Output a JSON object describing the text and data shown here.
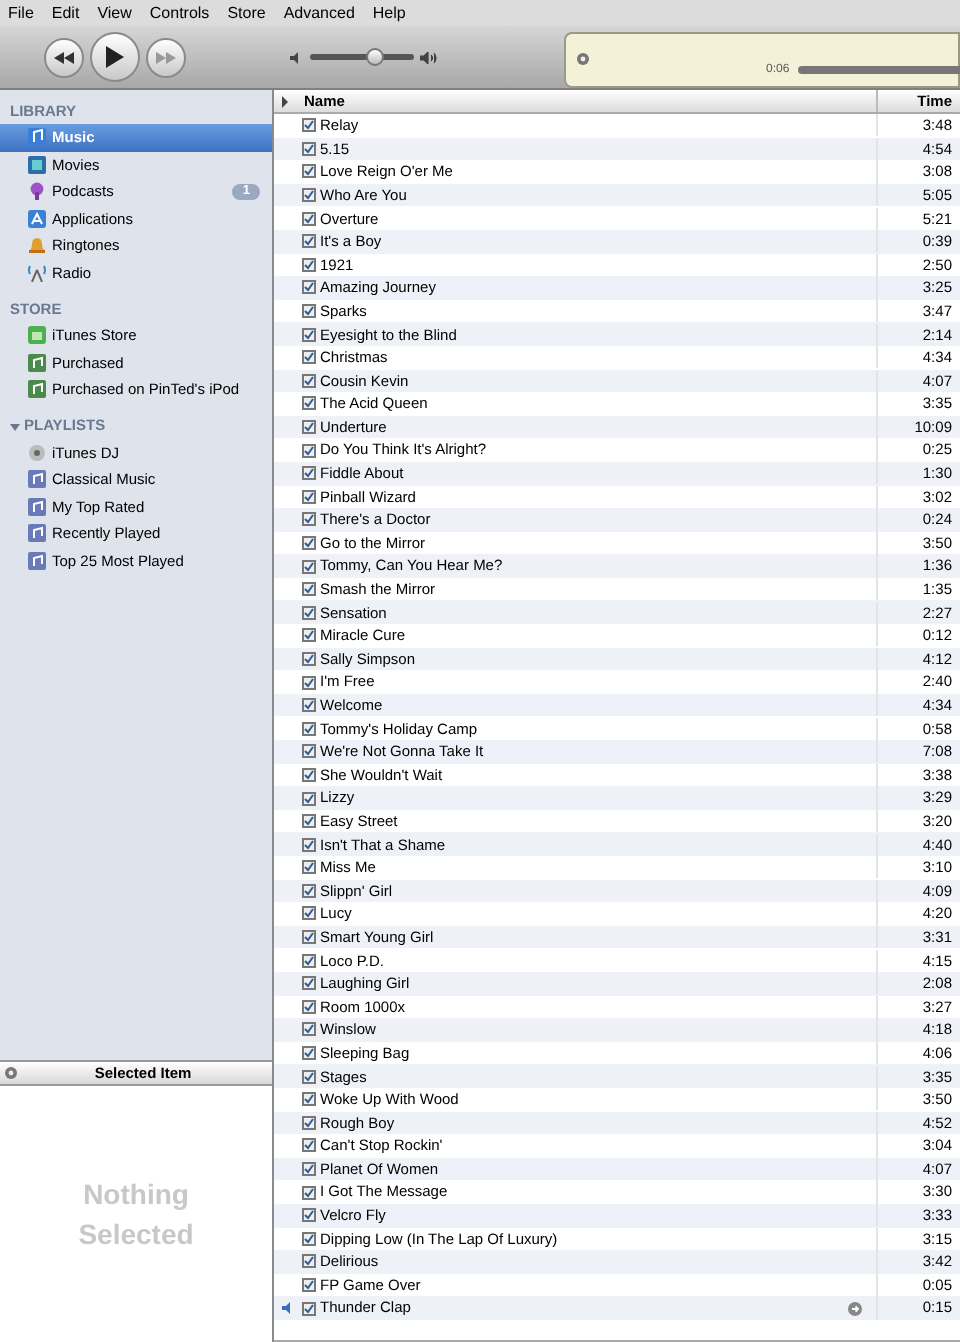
{
  "menu": [
    "File",
    "Edit",
    "View",
    "Controls",
    "Store",
    "Advanced",
    "Help"
  ],
  "volume": {
    "level": 0.63
  },
  "display": {
    "elapsed": "0:06"
  },
  "sidebar": [
    {
      "heading": "LIBRARY",
      "items": [
        {
          "label": "Music",
          "kind": "music",
          "selected": true
        },
        {
          "label": "Movies",
          "kind": "movie",
          "selected": false
        },
        {
          "label": "Podcasts",
          "kind": "podcast",
          "selected": false,
          "badge": "1"
        },
        {
          "label": "Applications",
          "kind": "app",
          "selected": false
        },
        {
          "label": "Ringtones",
          "kind": "bell",
          "selected": false
        },
        {
          "label": "Radio",
          "kind": "radio",
          "selected": false
        }
      ]
    },
    {
      "heading": "STORE",
      "items": [
        {
          "label": "iTunes Store",
          "kind": "store",
          "selected": false
        },
        {
          "label": "Purchased",
          "kind": "purchased",
          "selected": false
        },
        {
          "label": "Purchased on PinTed's iPod",
          "kind": "purchased",
          "selected": false
        }
      ]
    },
    {
      "heading": "PLAYLISTS",
      "expanded": true,
      "items": [
        {
          "label": "iTunes DJ",
          "kind": "dj",
          "selected": false
        },
        {
          "label": "Classical Music",
          "kind": "playlist",
          "selected": false
        },
        {
          "label": "My Top Rated",
          "kind": "playlist",
          "selected": false
        },
        {
          "label": "Recently Played",
          "kind": "playlist",
          "selected": false
        },
        {
          "label": "Top 25 Most Played",
          "kind": "playlist",
          "selected": false
        }
      ]
    }
  ],
  "artwork": {
    "title": "Selected Item",
    "empty_text": "Nothing Selected"
  },
  "table": {
    "columns": [
      "Name",
      "Time"
    ],
    "rows": [
      {
        "name": "Relay",
        "time": "3:48",
        "checked": true,
        "playing": false
      },
      {
        "name": "5.15",
        "time": "4:54",
        "checked": true,
        "playing": false
      },
      {
        "name": "Love Reign O'er Me",
        "time": "3:08",
        "checked": true,
        "playing": false
      },
      {
        "name": "Who Are You",
        "time": "5:05",
        "checked": true,
        "playing": false
      },
      {
        "name": "Overture",
        "time": "5:21",
        "checked": true,
        "playing": false
      },
      {
        "name": "It's a Boy",
        "time": "0:39",
        "checked": true,
        "playing": false
      },
      {
        "name": "1921",
        "time": "2:50",
        "checked": true,
        "playing": false
      },
      {
        "name": "Amazing Journey",
        "time": "3:25",
        "checked": true,
        "playing": false
      },
      {
        "name": "Sparks",
        "time": "3:47",
        "checked": true,
        "playing": false
      },
      {
        "name": "Eyesight to the Blind",
        "time": "2:14",
        "checked": true,
        "playing": false
      },
      {
        "name": "Christmas",
        "time": "4:34",
        "checked": true,
        "playing": false
      },
      {
        "name": "Cousin Kevin",
        "time": "4:07",
        "checked": true,
        "playing": false
      },
      {
        "name": "The Acid Queen",
        "time": "3:35",
        "checked": true,
        "playing": false
      },
      {
        "name": "Underture",
        "time": "10:09",
        "checked": true,
        "playing": false
      },
      {
        "name": "Do You Think It's Alright?",
        "time": "0:25",
        "checked": true,
        "playing": false
      },
      {
        "name": "Fiddle About",
        "time": "1:30",
        "checked": true,
        "playing": false
      },
      {
        "name": "Pinball Wizard",
        "time": "3:02",
        "checked": true,
        "playing": false
      },
      {
        "name": "There's a Doctor",
        "time": "0:24",
        "checked": true,
        "playing": false
      },
      {
        "name": "Go to the Mirror",
        "time": "3:50",
        "checked": true,
        "playing": false
      },
      {
        "name": "Tommy, Can You Hear Me?",
        "time": "1:36",
        "checked": true,
        "playing": false
      },
      {
        "name": "Smash the Mirror",
        "time": "1:35",
        "checked": true,
        "playing": false
      },
      {
        "name": "Sensation",
        "time": "2:27",
        "checked": true,
        "playing": false
      },
      {
        "name": "Miracle Cure",
        "time": "0:12",
        "checked": true,
        "playing": false
      },
      {
        "name": "Sally Simpson",
        "time": "4:12",
        "checked": true,
        "playing": false
      },
      {
        "name": "I'm Free",
        "time": "2:40",
        "checked": true,
        "playing": false
      },
      {
        "name": "Welcome",
        "time": "4:34",
        "checked": true,
        "playing": false
      },
      {
        "name": "Tommy's Holiday Camp",
        "time": "0:58",
        "checked": true,
        "playing": false
      },
      {
        "name": "We're Not Gonna Take It",
        "time": "7:08",
        "checked": true,
        "playing": false
      },
      {
        "name": "She Wouldn't Wait",
        "time": "3:38",
        "checked": true,
        "playing": false
      },
      {
        "name": "Lizzy",
        "time": "3:29",
        "checked": true,
        "playing": false
      },
      {
        "name": "Easy Street",
        "time": "3:20",
        "checked": true,
        "playing": false
      },
      {
        "name": "Isn't That a Shame",
        "time": "4:40",
        "checked": true,
        "playing": false
      },
      {
        "name": "Miss Me",
        "time": "3:10",
        "checked": true,
        "playing": false
      },
      {
        "name": "Slippn' Girl",
        "time": "4:09",
        "checked": true,
        "playing": false
      },
      {
        "name": "Lucy",
        "time": "4:20",
        "checked": true,
        "playing": false
      },
      {
        "name": "Smart Young Girl",
        "time": "3:31",
        "checked": true,
        "playing": false
      },
      {
        "name": "Loco P.D.",
        "time": "4:15",
        "checked": true,
        "playing": false
      },
      {
        "name": "Laughing Girl",
        "time": "2:08",
        "checked": true,
        "playing": false
      },
      {
        "name": "Room 1000x",
        "time": "3:27",
        "checked": true,
        "playing": false
      },
      {
        "name": "Winslow",
        "time": "4:18",
        "checked": true,
        "playing": false
      },
      {
        "name": "Sleeping Bag",
        "time": "4:06",
        "checked": true,
        "playing": false
      },
      {
        "name": "Stages",
        "time": "3:35",
        "checked": true,
        "playing": false
      },
      {
        "name": "Woke Up With Wood",
        "time": "3:50",
        "checked": true,
        "playing": false
      },
      {
        "name": "Rough Boy",
        "time": "4:52",
        "checked": true,
        "playing": false
      },
      {
        "name": "Can't Stop Rockin'",
        "time": "3:04",
        "checked": true,
        "playing": false
      },
      {
        "name": "Planet Of Women",
        "time": "4:07",
        "checked": true,
        "playing": false
      },
      {
        "name": "I Got The Message",
        "time": "3:30",
        "checked": true,
        "playing": false
      },
      {
        "name": "Velcro Fly",
        "time": "3:33",
        "checked": true,
        "playing": false
      },
      {
        "name": "Dipping Low (In The Lap Of Luxury)",
        "time": "3:15",
        "checked": true,
        "playing": false
      },
      {
        "name": "Delirious",
        "time": "3:42",
        "checked": true,
        "playing": false
      },
      {
        "name": "FP Game Over",
        "time": "0:05",
        "checked": true,
        "playing": false
      },
      {
        "name": "Thunder Clap",
        "time": "0:15",
        "checked": true,
        "playing": true
      }
    ]
  }
}
